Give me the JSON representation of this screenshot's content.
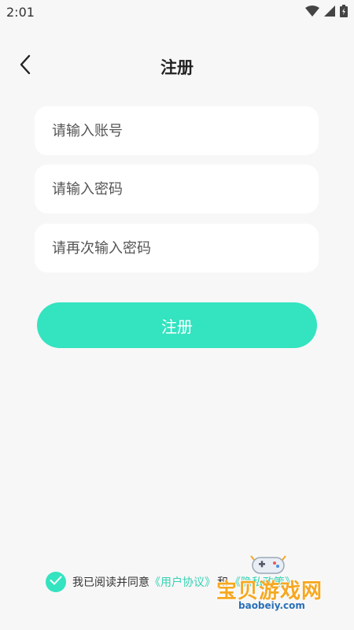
{
  "status_bar": {
    "time": "2:01"
  },
  "header": {
    "title": "注册"
  },
  "form": {
    "account_placeholder": "请输入账号",
    "password_placeholder": "请输入密码",
    "confirm_placeholder": "请再次输入密码",
    "submit_label": "注册"
  },
  "agreement": {
    "prefix": "我已阅读并同意",
    "user_agreement": "《用户协议》",
    "and": "和",
    "privacy_policy": "《隐私政策》",
    "checked": true
  },
  "watermark": {
    "text": "宝贝游戏网",
    "url": "baobeiy.com"
  },
  "colors": {
    "accent": "#34e3c0",
    "background": "#f7f7f7",
    "field_background": "#ffffff"
  }
}
